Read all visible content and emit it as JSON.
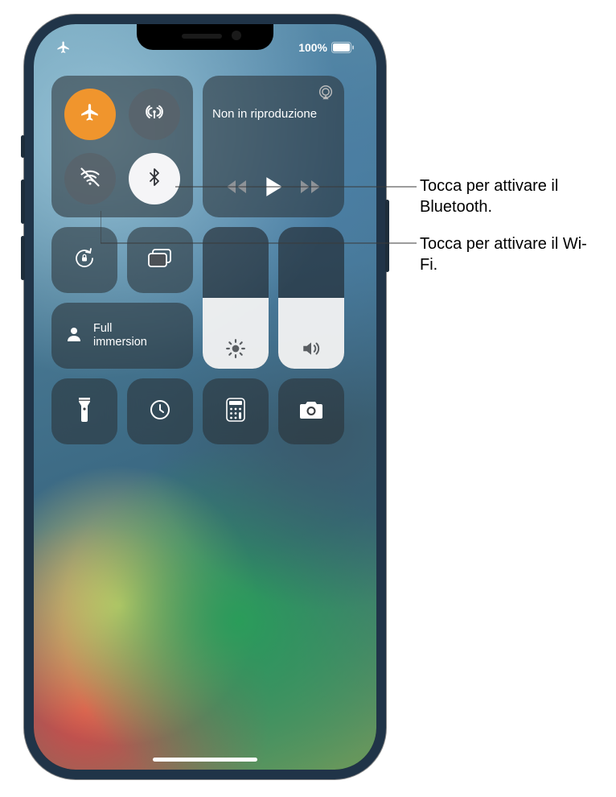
{
  "status": {
    "battery_text": "100%",
    "battery_pct": 100
  },
  "connectivity": {
    "airplane": true,
    "cellular": false,
    "wifi": false,
    "bluetooth": true
  },
  "media": {
    "title": "Non in riproduzione"
  },
  "focus": {
    "label": "Full\nimmersion"
  },
  "sliders": {
    "brightness_pct": 50,
    "volume_pct": 50
  },
  "callouts": {
    "bluetooth": "Tocca per attivare il Bluetooth.",
    "wifi": "Tocca per attivare il Wi-Fi."
  }
}
